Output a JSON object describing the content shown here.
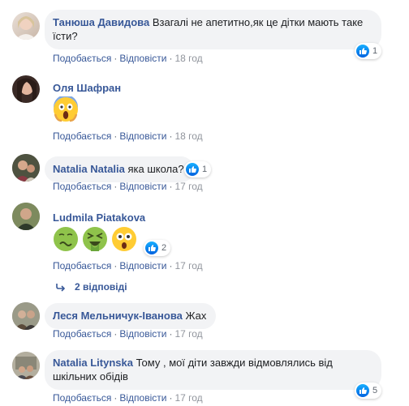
{
  "actions": {
    "like": "Подобається",
    "reply": "Відповісти",
    "sep": "·"
  },
  "comments": [
    {
      "author": "Танюша Давидова",
      "text": "Взагалі не апетитно,як це дітки мають таке їсти?",
      "time": "18 год",
      "reactions": "1"
    },
    {
      "author": "Оля Шафран",
      "text": "",
      "time": "18 год",
      "reactions": ""
    },
    {
      "author": "Natalia Natalia",
      "text": "яка школа?",
      "time": "17 год",
      "reactions": "1"
    },
    {
      "author": "Ludmila Piatakova",
      "text": "",
      "time": "17 год",
      "reactions": "2"
    },
    {
      "author": "Леся Мельничук-Іванова",
      "text": "Жах",
      "time": "17 год",
      "reactions": ""
    },
    {
      "author": "Natalia Litynska",
      "text": "Тому , мої діти завжди відмовлялись від шкільних обідів",
      "time": "17 год",
      "reactions": "5"
    }
  ],
  "replies_label": "2 відповіді",
  "colors": {
    "link": "#385898",
    "bubble": "#f2f3f5",
    "like_blue": "#1877f2"
  }
}
